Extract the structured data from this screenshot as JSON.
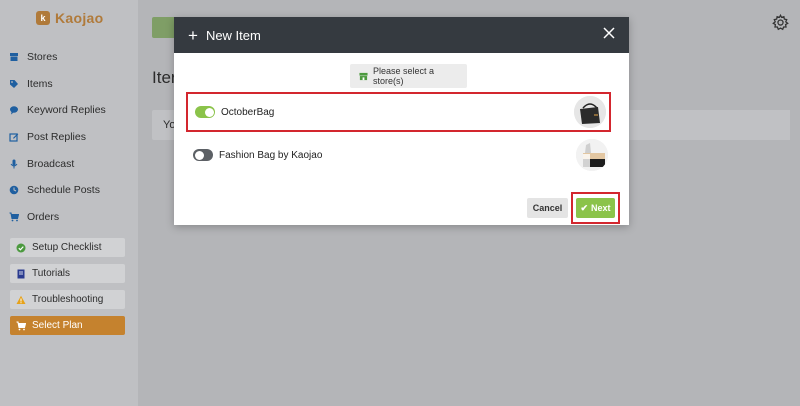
{
  "brand": {
    "name": "Kaojao"
  },
  "sidebar": {
    "items": [
      {
        "label": "Stores",
        "icon": "store-icon"
      },
      {
        "label": "Items",
        "icon": "tag-icon"
      },
      {
        "label": "Keyword Replies",
        "icon": "chat-bubble-icon"
      },
      {
        "label": "Post Replies",
        "icon": "edit-icon"
      },
      {
        "label": "Broadcast",
        "icon": "microphone-icon"
      },
      {
        "label": "Schedule Posts",
        "icon": "clock-icon"
      },
      {
        "label": "Orders",
        "icon": "cart-icon"
      }
    ],
    "help": [
      {
        "label": "Setup Checklist",
        "icon": "check-circle-icon"
      },
      {
        "label": "Tutorials",
        "icon": "book-icon"
      },
      {
        "label": "Troubleshooting",
        "icon": "warning-icon"
      },
      {
        "label": "Select Plan",
        "icon": "cart-icon"
      }
    ]
  },
  "background_page": {
    "title": "Iter",
    "card_text": "Yo"
  },
  "modal": {
    "title": "New Item",
    "store_select_label": "Please select a store(s)",
    "stores": [
      {
        "name": "OctoberBag",
        "enabled": true
      },
      {
        "name": "Fashion Bag by Kaojao",
        "enabled": false
      }
    ],
    "cancel_label": "Cancel",
    "next_label": "Next"
  },
  "colors": {
    "accent_green": "#8bc34a",
    "highlight_red": "#d3262e",
    "brand_orange": "#c5822e",
    "modal_header": "#353a40"
  }
}
